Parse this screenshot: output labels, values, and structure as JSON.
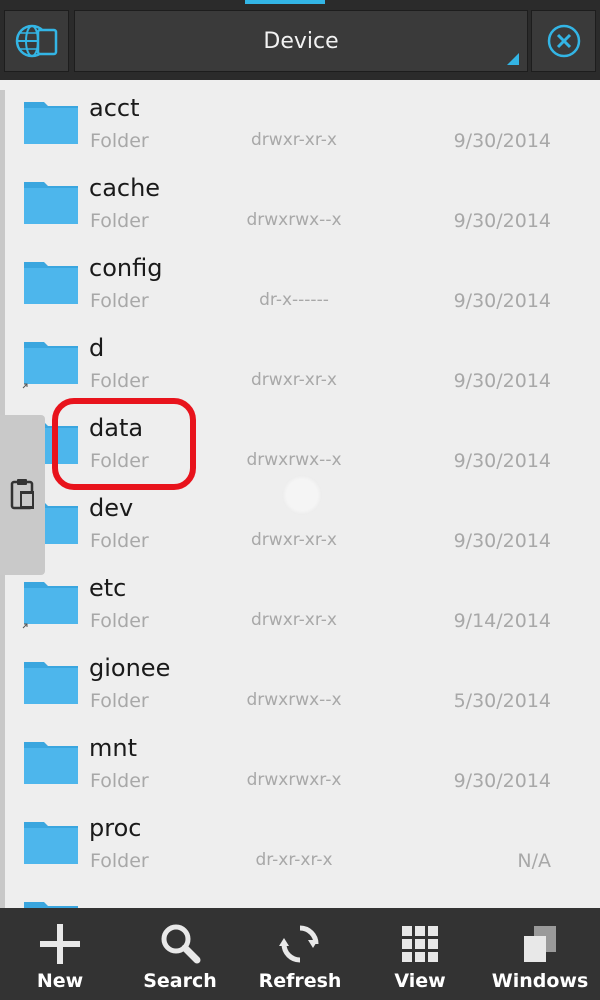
{
  "header": {
    "location_title": "Device"
  },
  "files": [
    {
      "name": "acct",
      "type": "Folder",
      "permissions": "drwxr-xr-x",
      "date": "9/30/2014",
      "link": false
    },
    {
      "name": "cache",
      "type": "Folder",
      "permissions": "drwxrwx--x",
      "date": "9/30/2014",
      "link": false
    },
    {
      "name": "config",
      "type": "Folder",
      "permissions": "dr-x------",
      "date": "9/30/2014",
      "link": false
    },
    {
      "name": "d",
      "type": "Folder",
      "permissions": "drwxr-xr-x",
      "date": "9/30/2014",
      "link": true
    },
    {
      "name": "data",
      "type": "Folder",
      "permissions": "drwxrwx--x",
      "date": "9/30/2014",
      "link": false
    },
    {
      "name": "dev",
      "type": "Folder",
      "permissions": "drwxr-xr-x",
      "date": "9/30/2014",
      "link": false
    },
    {
      "name": "etc",
      "type": "Folder",
      "permissions": "drwxr-xr-x",
      "date": "9/14/2014",
      "link": true
    },
    {
      "name": "gionee",
      "type": "Folder",
      "permissions": "drwxrwx--x",
      "date": "5/30/2014",
      "link": false
    },
    {
      "name": "mnt",
      "type": "Folder",
      "permissions": "drwxrwxr-x",
      "date": "9/30/2014",
      "link": false
    },
    {
      "name": "proc",
      "type": "Folder",
      "permissions": "dr-xr-xr-x",
      "date": "N/A",
      "link": false
    }
  ],
  "toolbar": [
    {
      "label": "New",
      "icon": "plus-icon"
    },
    {
      "label": "Search",
      "icon": "search-icon"
    },
    {
      "label": "Refresh",
      "icon": "refresh-icon"
    },
    {
      "label": "View",
      "icon": "grid-view-icon"
    },
    {
      "label": "Windows",
      "icon": "windows-stack-icon"
    }
  ],
  "colors": {
    "accent": "#33b5e5",
    "folder": "#4db6ec",
    "highlight": "#e8131c",
    "topbar": "#2b2b2b",
    "bottombar": "#333333"
  }
}
